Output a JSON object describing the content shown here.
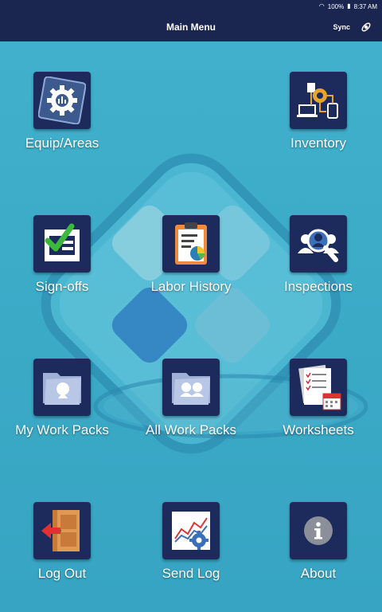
{
  "status_bar": {
    "battery": "100%",
    "time": "8:37 AM"
  },
  "header": {
    "title": "Main Menu",
    "sync_label": "Sync"
  },
  "menu": {
    "equip_areas": "Equip/Areas",
    "inventory": "Inventory",
    "sign_offs": "Sign-offs",
    "labor_history": "Labor History",
    "inspections": "Inspections",
    "my_work_packs": "My Work Packs",
    "all_work_packs": "All Work Packs",
    "worksheets": "Worksheets",
    "log_out": "Log Out",
    "send_log": "Send Log",
    "about": "About"
  },
  "colors": {
    "header_bg": "#1a2650",
    "background": "#3ba9c7",
    "tile_bg": "#1d2b5c"
  }
}
